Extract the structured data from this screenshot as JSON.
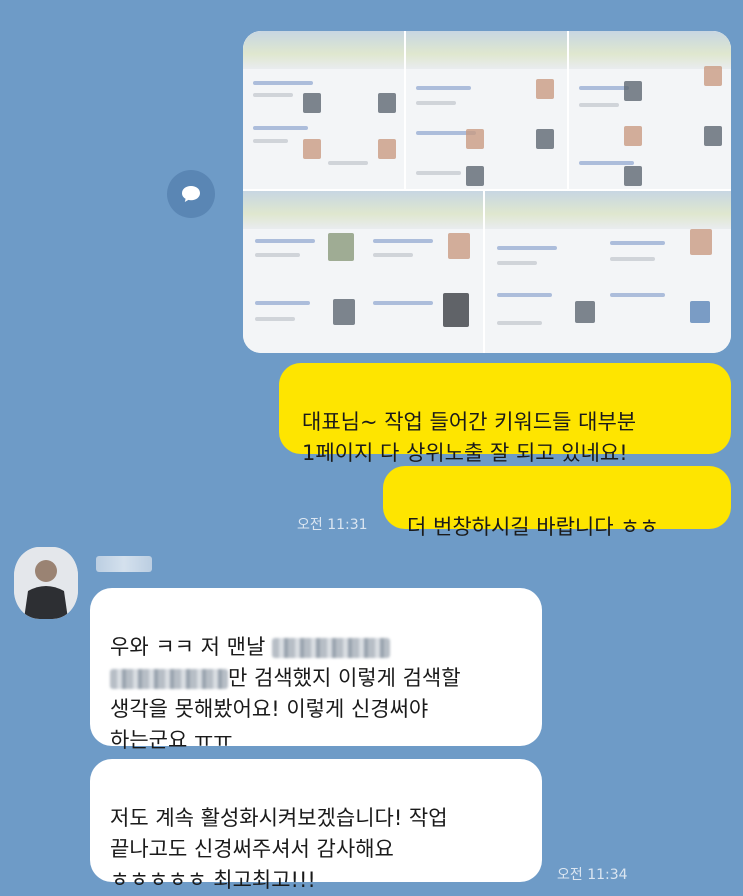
{
  "messages": {
    "me_1": "대표님~ 작업 들어간 키워드들 대부분\n1페이지 다 상위노출 잘 되고 있네요!",
    "me_2": "더 번창하시길 바랍니다 ㅎㅎ",
    "me_time": "오전 11:31",
    "other_1_a": "우와 ㅋㅋ 저 맨날 ",
    "other_1_b": "만 검색했지 이렇게 검색할\n생각을 못해봤어요! 이렇게 신경써야\n하는군요 ㅠㅠ",
    "other_2": "저도 계속 활성화시켜보겠습니다! 작업\n끝나고도 신경써주셔서 감사해요\nㅎㅎㅎㅎㅎ 최고최고!!!",
    "other_time": "오전 11:34"
  },
  "icons": {
    "share": "share-bubble-icon",
    "avatar": "profile-photo"
  },
  "colors": {
    "background": "#6e9bc7",
    "my_bubble": "#fee500",
    "their_bubble": "#ffffff"
  }
}
